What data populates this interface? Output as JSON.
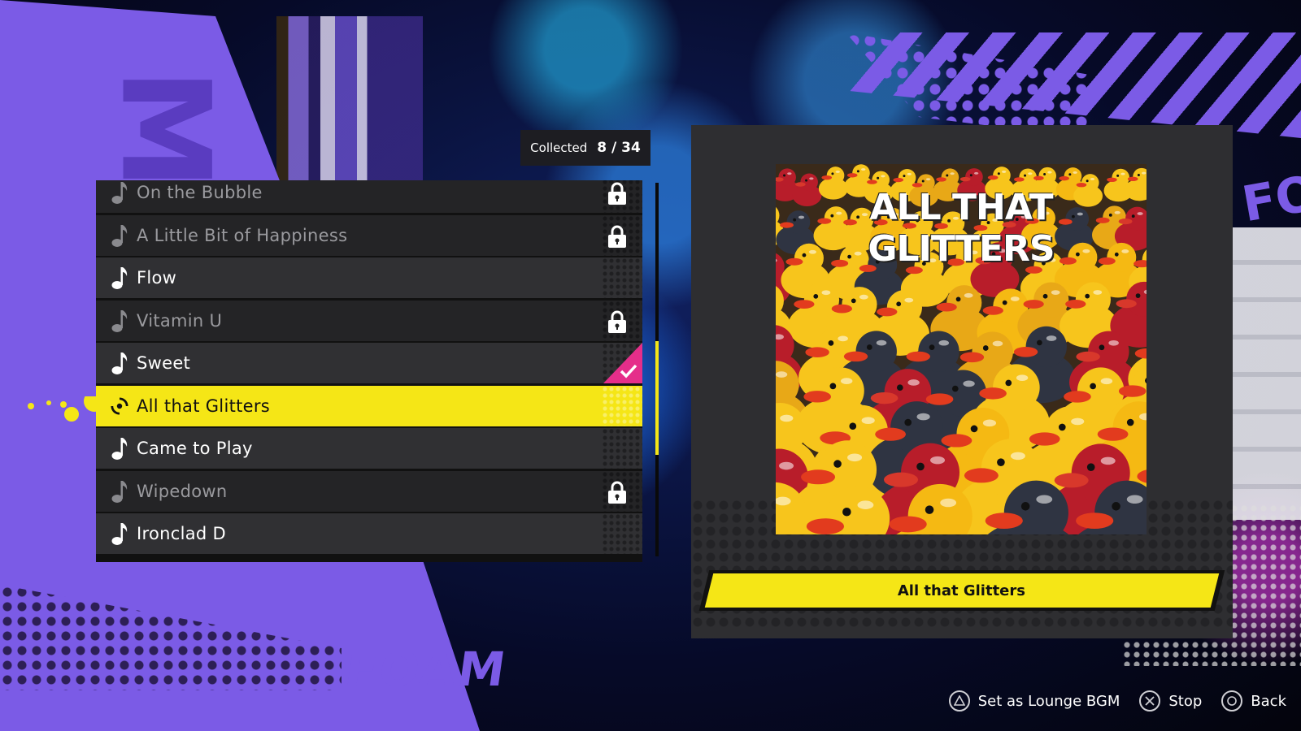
{
  "collected": {
    "label": "Collected",
    "count": "8 / 34"
  },
  "songs": [
    {
      "title": "On the Bubble",
      "status": "locked"
    },
    {
      "title": "A Little Bit of Happiness",
      "status": "locked"
    },
    {
      "title": "Flow",
      "status": "unlocked"
    },
    {
      "title": "Vitamin U",
      "status": "locked"
    },
    {
      "title": "Sweet",
      "status": "set"
    },
    {
      "title": "All that Glitters",
      "status": "selected"
    },
    {
      "title": "Came to Play",
      "status": "unlocked"
    },
    {
      "title": "Wipedown",
      "status": "locked"
    },
    {
      "title": "Ironclad D",
      "status": "unlocked"
    }
  ],
  "preview": {
    "cover_text": "ALL THAT GLITTERS",
    "title": "All that Glitters"
  },
  "controls": {
    "set_bgm": "Set as Lounge BGM",
    "stop": "Stop",
    "back": "Back"
  },
  "colors": {
    "accent_yellow": "#f5e616",
    "purple": "#7b5be6",
    "pink_check": "#e52e8a",
    "row_bg": "#303033"
  }
}
